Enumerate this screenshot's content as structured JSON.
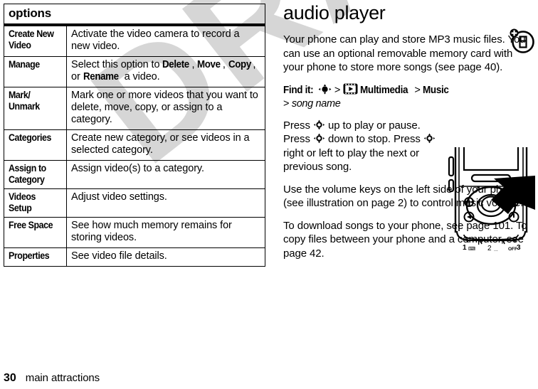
{
  "document": {
    "watermark_text": "DRAFT",
    "watermark_color": "#d6d6d6"
  },
  "options_table": {
    "header": "options",
    "rows": [
      {
        "label": "Create New Video",
        "description": "Activate the video camera to record a new video."
      },
      {
        "label": "Manage",
        "description_parts": [
          {
            "text": "Select this option to ",
            "bold": false
          },
          {
            "text": "Delete",
            "bold": true
          },
          {
            "text": ", ",
            "bold": false
          },
          {
            "text": "Move",
            "bold": true
          },
          {
            "text": ", ",
            "bold": false
          },
          {
            "text": "Copy",
            "bold": true
          },
          {
            "text": ", or ",
            "bold": false
          },
          {
            "text": "Rename",
            "bold": true
          },
          {
            "text": " a video.",
            "bold": false
          }
        ]
      },
      {
        "label": "Mark/ Unmark",
        "description": "Mark one or more videos that you want to delete, move, copy, or assign to a category."
      },
      {
        "label": "Categories",
        "description": "Create new category, or see videos in a selected category."
      },
      {
        "label": "Assign to Category",
        "description": "Assign video(s) to a category."
      },
      {
        "label": "Videos Setup",
        "description": "Adjust video settings."
      },
      {
        "label": "Free Space",
        "description": "See how much memory remains for storing videos."
      },
      {
        "label": "Properties",
        "description": "See video file details."
      }
    ]
  },
  "audio_player": {
    "title": "audio player",
    "intro": "Your phone can play and store MP3 music files. You can use an optional removable memory card with your phone to store more songs (see page 40).",
    "find_it": {
      "label": "Find it:",
      "joystick_icon": "joystick-icon",
      "separator": ">",
      "multimedia_icon": "multimedia-icon",
      "multimedia_label": "Multimedia",
      "music_label": "Music",
      "song_label": "song name"
    },
    "paragraphs": [
      "Press S up to play or pause. Press S down to stop. Press S right or left to play the next or previous song.",
      "Use the volume keys on the left side of your phone (see illustration on page 2) to control music volume.",
      "To download songs to your phone, see page 101. To copy files between your phone and a computer, see page 42."
    ],
    "press_text": {
      "seg1": "Press ",
      "seg2": " up to play or pause. Press ",
      "seg3": " down to stop. Press ",
      "seg4": " right or left to play the next or previous song."
    },
    "volume_text": "Use the volume keys on the left side of your phone (see illustration on page 2) to control music volume.",
    "download_text": "To download songs to your phone, see page 101. To copy files between your phone and a computer, see page 42.",
    "margin_icon": "memory-card-badge-icon",
    "illustration": "phone-navigation-key-illustration"
  },
  "footer": {
    "page_number": "30",
    "chapter": "main attractions"
  }
}
